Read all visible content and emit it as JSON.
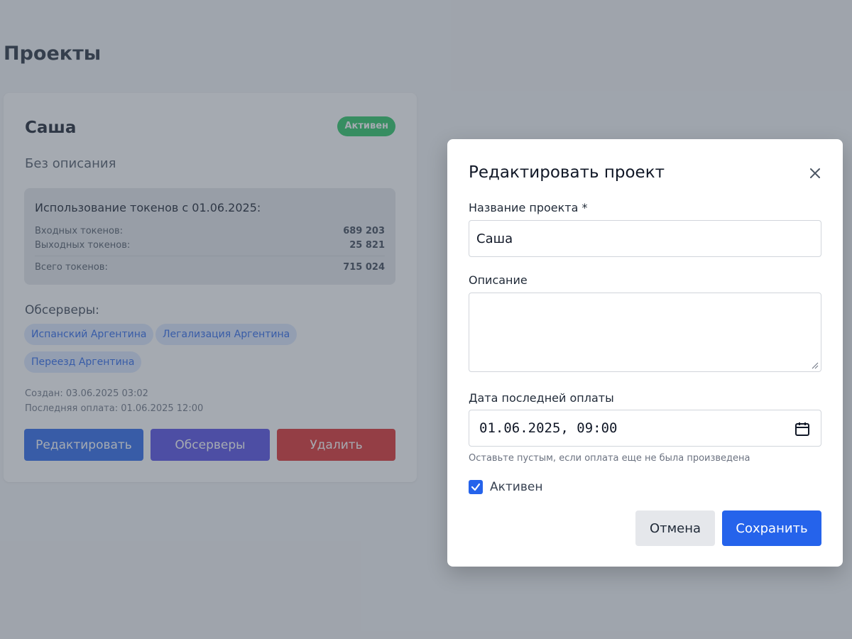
{
  "page": {
    "title": "Проекты"
  },
  "project": {
    "name": "Саша",
    "status": "Активен",
    "description": "Без описания",
    "usage": {
      "title": "Использование токенов с 01.06.2025:",
      "input_label": "Входных токенов:",
      "input_value": "689 203",
      "output_label": "Выходных токенов:",
      "output_value": "25 821",
      "total_label": "Всего токенов:",
      "total_value": "715 024"
    },
    "observers_label": "Обсерверы:",
    "observers": [
      "Испанский Аргентина",
      "Легализация Аргентина",
      "Переезд Аргентина"
    ],
    "created": "Создан: 03.06.2025 03:02",
    "last_payment": "Последняя оплата: 01.06.2025 12:00",
    "buttons": {
      "edit": "Редактировать",
      "observers": "Обсерверы",
      "delete": "Удалить"
    },
    "colors": {
      "edit": "#2563eb",
      "observers": "#4f46e5",
      "delete": "#dc2626",
      "badge": "#22c55e"
    }
  },
  "modal": {
    "title": "Редактировать проект",
    "close_icon": "close-icon",
    "name_label": "Название проекта *",
    "name_value": "Саша",
    "description_label": "Описание",
    "description_value": "",
    "date_label": "Дата последней оплаты",
    "date_value": "01.06.2025, 09:00",
    "date_hint": "Оставьте пустым, если оплата еще не была произведена",
    "active_label": "Активен",
    "active_checked": true,
    "cancel": "Отмена",
    "save": "Сохранить"
  }
}
